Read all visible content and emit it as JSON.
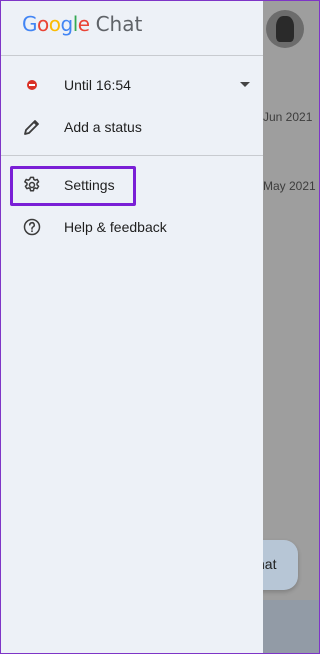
{
  "drawer": {
    "logo_google": "Google",
    "logo_product": "Chat",
    "status": {
      "label": "Until 16:54",
      "icon": "do-not-disturb-icon"
    },
    "add_status": {
      "label": "Add a status",
      "icon": "pencil-icon"
    },
    "settings": {
      "label": "Settings",
      "icon": "gear-icon"
    },
    "help": {
      "label": "Help & feedback",
      "icon": "help-icon"
    }
  },
  "background": {
    "date_1": "Jun 2021",
    "date_2": "May 2021",
    "chat_button": "hat"
  },
  "colors": {
    "highlight": "#7a1fd6",
    "google_blue": "#4285f4",
    "google_red": "#ea4335",
    "google_yellow": "#fbbc05",
    "google_green": "#34a853"
  }
}
